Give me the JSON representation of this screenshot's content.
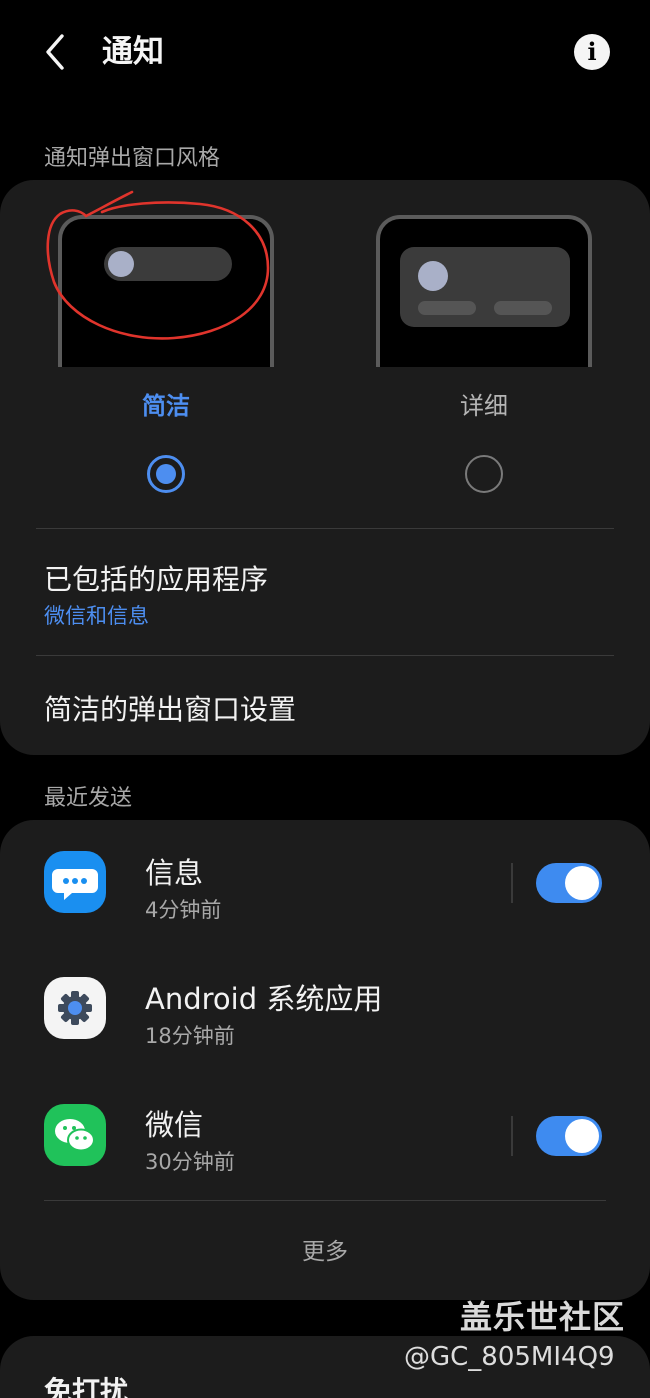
{
  "header": {
    "title": "通知"
  },
  "popup_style": {
    "section_label": "通知弹出窗口风格",
    "options": [
      {
        "label": "简洁",
        "selected": true,
        "color": "#4d8ef0"
      },
      {
        "label": "详细",
        "selected": false,
        "color": "#b5b5b5"
      }
    ]
  },
  "settings": {
    "included_apps": {
      "title": "已包括的应用程序",
      "value": "微信和信息"
    },
    "brief_settings": {
      "title": "简洁的弹出窗口设置"
    }
  },
  "recent": {
    "section_label": "最近发送",
    "apps": [
      {
        "name": "信息",
        "time": "4分钟前",
        "toggle": true
      },
      {
        "name": "Android 系统应用",
        "time": "18分钟前",
        "toggle": null
      },
      {
        "name": "微信",
        "time": "30分钟前",
        "toggle": true
      }
    ],
    "more_label": "更多"
  },
  "dnd": {
    "title": "免打扰"
  },
  "watermark": {
    "line1": "盖乐世社区",
    "line2": "@GC_805MI4Q9"
  },
  "colors": {
    "accent": "#4d8ef0",
    "card": "#1c1c1c",
    "background": "#000000",
    "annotation": "#e0342c"
  }
}
